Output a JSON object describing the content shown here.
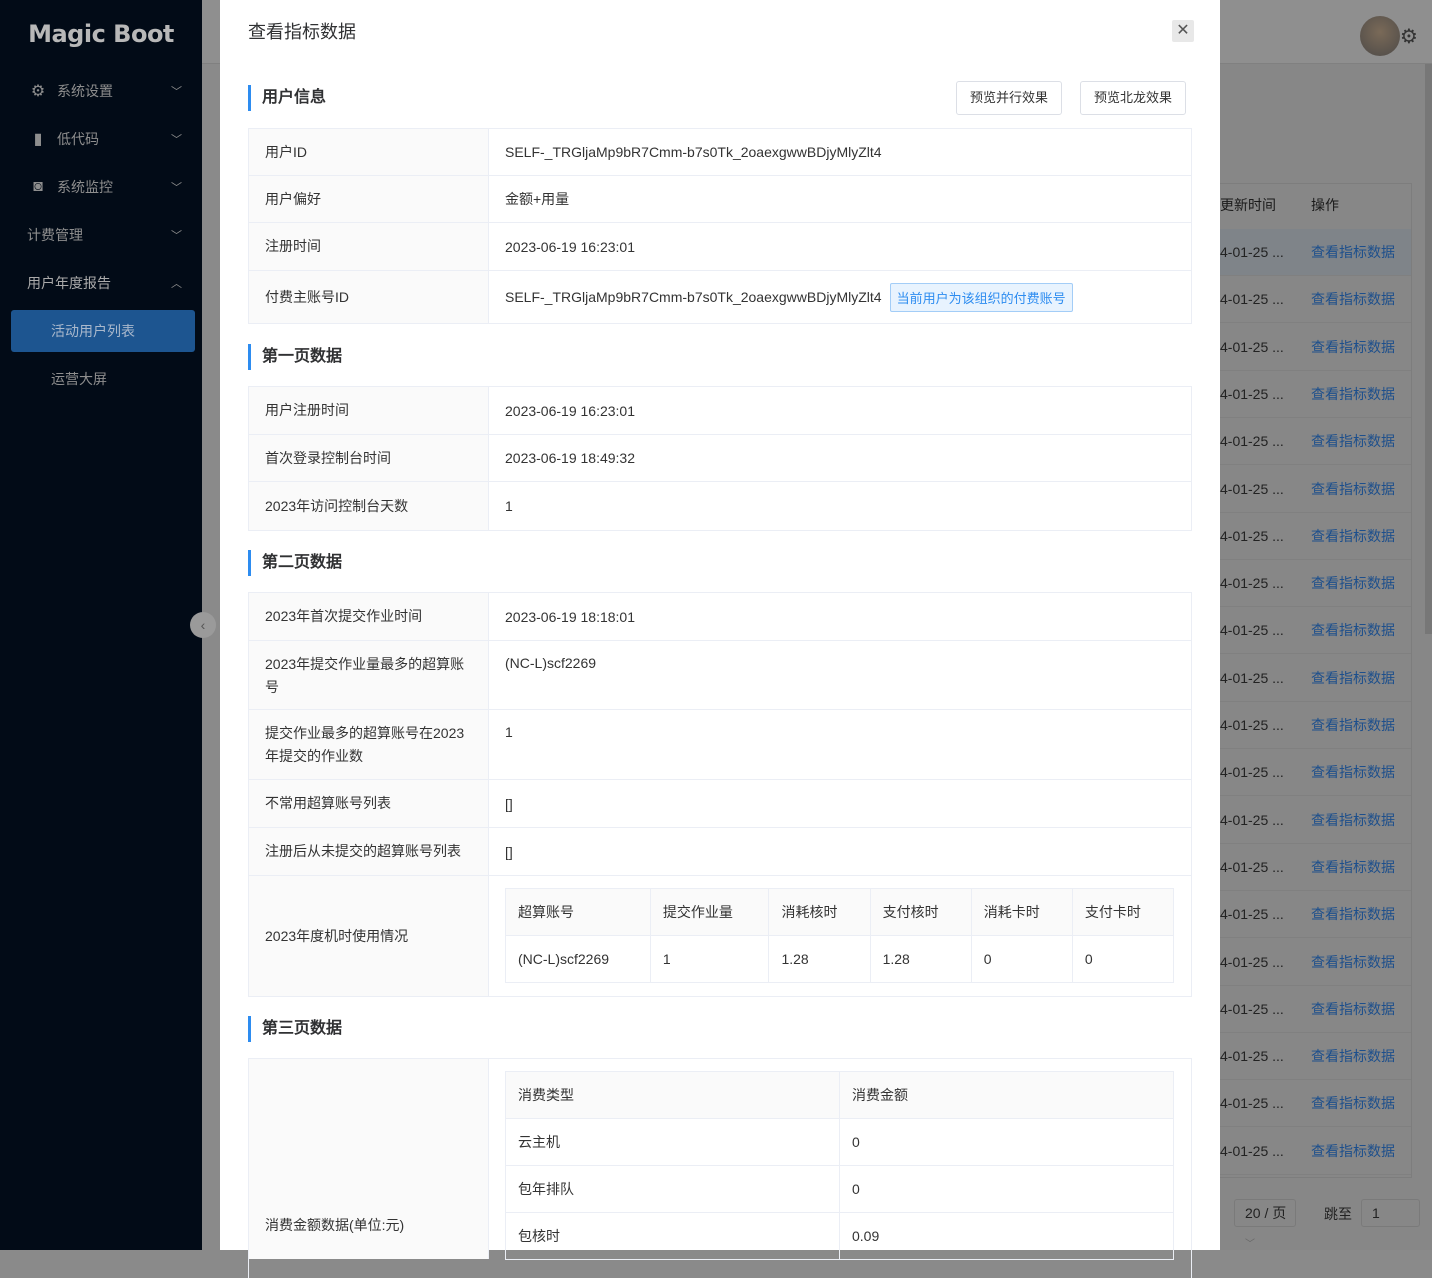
{
  "sidebar": {
    "logo": "Magic Boot",
    "items": [
      {
        "label": "系统设置",
        "icon": "gear-icon"
      },
      {
        "label": "低代码",
        "icon": "clipboard-code-icon"
      },
      {
        "label": "系统监控",
        "icon": "camera-icon"
      },
      {
        "label": "计费管理"
      },
      {
        "label": "用户年度报告",
        "expanded": true
      },
      {
        "label": "活动用户列表",
        "active": true
      },
      {
        "label": "运营大屏"
      }
    ]
  },
  "background": {
    "columns": [
      "更新时间",
      "操作"
    ],
    "row_date": "4-01-25 ...",
    "row_link": "查看指标数据",
    "row_count": 20,
    "page_size": "20 / 页",
    "jump_label": "跳至",
    "jump_value": "1"
  },
  "modal": {
    "title": "查看指标数据",
    "buttons": {
      "parallel": "预览并行效果",
      "beilong": "预览北龙效果"
    },
    "sections": [
      {
        "title": "用户信息",
        "rows": [
          {
            "label": "用户ID",
            "value": "SELF-_TRGljaMp9bR7Cmm-b7s0Tk_2oaexgwwBDjyMlyZlt4"
          },
          {
            "label": "用户偏好",
            "value": "金额+用量"
          },
          {
            "label": "注册时间",
            "value": "2023-06-19 16:23:01"
          },
          {
            "label": "付费主账号ID",
            "value": "SELF-_TRGljaMp9bR7Cmm-b7s0Tk_2oaexgwwBDjyMlyZlt4",
            "tag": "当前用户为该组织的付费账号"
          }
        ]
      },
      {
        "title": "第一页数据",
        "rows": [
          {
            "label": "用户注册时间",
            "value": "2023-06-19 16:23:01"
          },
          {
            "label": "首次登录控制台时间",
            "value": "2023-06-19 18:49:32"
          },
          {
            "label": "2023年访问控制台天数",
            "value": "1"
          }
        ]
      },
      {
        "title": "第二页数据",
        "rows": [
          {
            "label": "2023年首次提交作业时间",
            "value": "2023-06-19 18:18:01"
          },
          {
            "label": "2023年提交作业量最多的超算账号",
            "value": "(NC-L)scf2269"
          },
          {
            "label": "提交作业最多的超算账号在2023年提交的作业数",
            "value": "1"
          },
          {
            "label": "不常用超算账号列表",
            "value": "[]"
          },
          {
            "label": "注册后从未提交的超算账号列表",
            "value": "[]"
          },
          {
            "label": "2023年度机时使用情况",
            "table": {
              "headers": [
                "超算账号",
                "提交作业量",
                "消耗核时",
                "支付核时",
                "消耗卡时",
                "支付卡时"
              ],
              "rows": [
                [
                  "(NC-L)scf2269",
                  "1",
                  "1.28",
                  "1.28",
                  "0",
                  "0"
                ]
              ]
            }
          }
        ]
      },
      {
        "title": "第三页数据",
        "rows": [
          {
            "label": "消费金额数据(单位:元)",
            "table": {
              "headers": [
                "消费类型",
                "消费金额"
              ],
              "rows": [
                [
                  "云主机",
                  "0"
                ],
                [
                  "包年排队",
                  "0"
                ],
                [
                  "包核时",
                  "0.09"
                ]
              ]
            }
          }
        ]
      }
    ]
  }
}
